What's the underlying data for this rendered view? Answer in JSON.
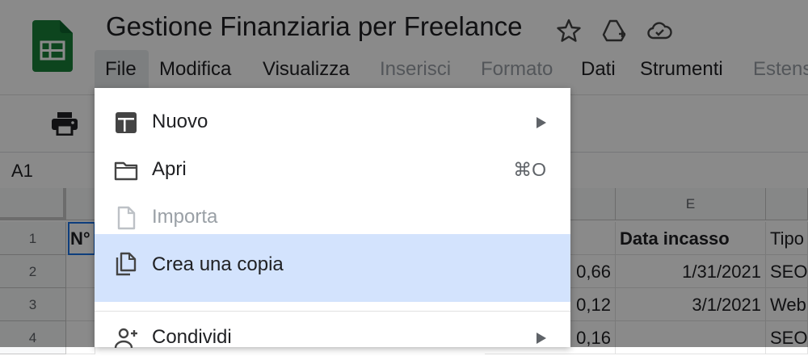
{
  "app": {
    "title": "Gestione Finanziaria per Freelance",
    "logo_icon": "google-sheets-icon",
    "title_icons": [
      "star-icon",
      "drive-add-icon",
      "cloud-saved-icon"
    ]
  },
  "menubar": {
    "items": [
      {
        "label": "File",
        "state": "open"
      },
      {
        "label": "Modifica",
        "state": "enabled"
      },
      {
        "label": "Visualizza",
        "state": "enabled"
      },
      {
        "label": "Inserisci",
        "state": "disabled"
      },
      {
        "label": "Formato",
        "state": "disabled"
      },
      {
        "label": "Dati",
        "state": "enabled"
      },
      {
        "label": "Strumenti",
        "state": "enabled"
      },
      {
        "label": "Estens",
        "state": "disabled"
      }
    ]
  },
  "toolbar": {
    "print_icon": "print-icon"
  },
  "formula_bar": {
    "cell_ref": "A1"
  },
  "grid": {
    "col_header_e": "E",
    "rows": [
      {
        "num": "1",
        "a": "N°",
        "d": "",
        "e": "Data incasso",
        "f": "Tipo"
      },
      {
        "num": "2",
        "a": "",
        "d": "0,66",
        "e": "1/31/2021",
        "f": "SEO"
      },
      {
        "num": "3",
        "a": "",
        "d": "0,12",
        "e": "3/1/2021",
        "f": "Web"
      },
      {
        "num": "4",
        "a": "",
        "d": "0,16",
        "e": "",
        "f": "SEO"
      }
    ]
  },
  "file_menu": {
    "items": [
      {
        "label": "Nuovo",
        "icon": "new-sheet-icon",
        "submenu": true,
        "disabled": false
      },
      {
        "label": "Apri",
        "icon": "folder-icon",
        "shortcut": "⌘O",
        "disabled": false
      },
      {
        "label": "Importa",
        "icon": "file-icon",
        "disabled": true
      },
      {
        "label": "Crea una copia",
        "icon": "copy-icon",
        "disabled": false,
        "highlighted": true
      },
      {
        "label": "Condividi",
        "icon": "add-person-icon",
        "submenu": true,
        "disabled": false
      }
    ]
  },
  "colors": {
    "highlight": "#d3e3fd",
    "sheets_green": "#188038",
    "selection_blue": "#1a73e8"
  }
}
